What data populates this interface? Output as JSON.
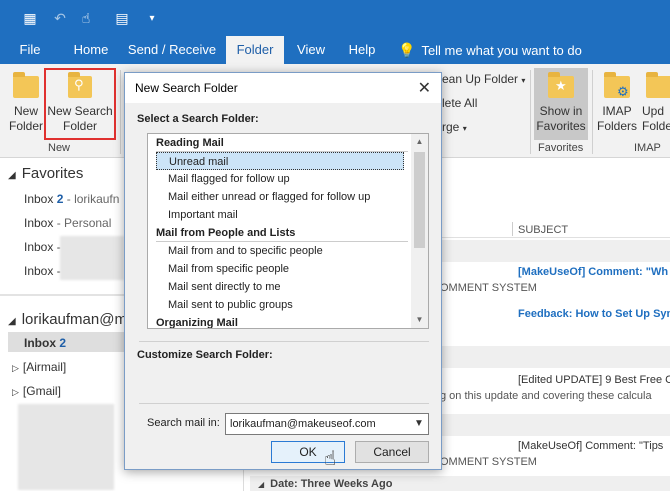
{
  "menu": {
    "tabs": [
      {
        "label": "File"
      },
      {
        "label": "Home"
      },
      {
        "label": "Send / Receive"
      },
      {
        "label": "Folder"
      },
      {
        "label": "View"
      },
      {
        "label": "Help"
      }
    ],
    "tellme": "Tell me what you want to do"
  },
  "ribbon": {
    "new_folder": [
      "New",
      "Folder"
    ],
    "new_search_folder": [
      "New Search",
      "Folder"
    ],
    "group_new": "New",
    "clean_up": "ean Up Folder",
    "delete_all": "lete All",
    "purge": "rge",
    "show_favorites": [
      "Show in",
      "Favorites"
    ],
    "group_favorites": "Favorites",
    "imap_folders": [
      "IMAP",
      "Folders"
    ],
    "update_folder": [
      "Upd",
      "Folde"
    ],
    "group_imap": "IMAP"
  },
  "leftpane": {
    "favorites": "Favorites",
    "inbox1": {
      "label": "Inbox",
      "count": "2",
      "account": "- lorikaufn"
    },
    "inbox2": {
      "label": "Inbox",
      "account": "- Personal"
    },
    "inbox3": {
      "label": "Inbox -"
    },
    "inbox4": {
      "label": "Inbox -"
    },
    "account": "lorikaufman@m",
    "inbox_sel": {
      "label": "Inbox",
      "count": "2"
    },
    "airmail": "[Airmail]",
    "gmail": "[Gmail]"
  },
  "rightpane": {
    "subject_header": "SUBJECT",
    "msg1_subject": "[MakeUseOf] Comment: \"Wh",
    "msg1_from": "OMMENT SYSTEM",
    "msg2_subject": "Feedback: How to Set Up Syn",
    "msg3_subject": "[Edited UPDATE] 9 Best Free C",
    "msg3_preview": "g on this update and covering these calcula",
    "msg4_subject": "[MakeUseOf] Comment: \"Tips",
    "msg4_from": "OMMENT SYSTEM",
    "date_group": "Date: Three Weeks Ago"
  },
  "dialog": {
    "title": "New Search Folder",
    "select_label": "Select a Search Folder:",
    "list": [
      {
        "type": "header",
        "label": "Reading Mail"
      },
      {
        "type": "item",
        "label": "Unread mail",
        "selected": true
      },
      {
        "type": "item",
        "label": "Mail flagged for follow up"
      },
      {
        "type": "item",
        "label": "Mail either unread or flagged for follow up"
      },
      {
        "type": "item",
        "label": "Important mail"
      },
      {
        "type": "header",
        "label": "Mail from People and Lists"
      },
      {
        "type": "item",
        "label": "Mail from and to specific people"
      },
      {
        "type": "item",
        "label": "Mail from specific people"
      },
      {
        "type": "item",
        "label": "Mail sent directly to me"
      },
      {
        "type": "item",
        "label": "Mail sent to public groups"
      },
      {
        "type": "header",
        "label": "Organizing Mail"
      }
    ],
    "customize_label": "Customize Search Folder:",
    "search_in_label": "Search mail in:",
    "search_in_value": "lorikaufman@makeuseof.com",
    "ok": "OK",
    "cancel": "Cancel"
  },
  "colors": {
    "titlebar": "#1f6fc0",
    "ribbon": "#f2f2f2",
    "highlight": "#e0312f",
    "selection": "#cce4f7"
  }
}
